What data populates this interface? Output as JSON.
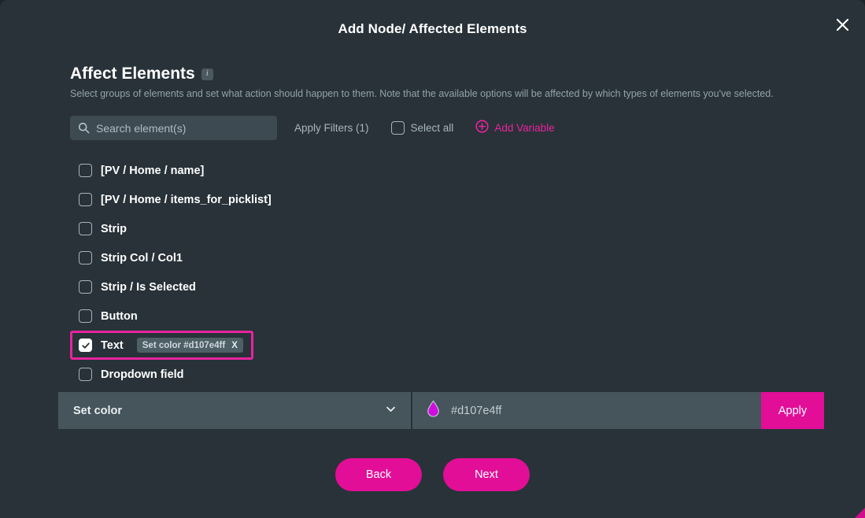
{
  "modal": {
    "title": "Add Node/ Affected Elements",
    "close_icon": "close-icon"
  },
  "section": {
    "title": "Affect Elements",
    "info_icon": "i",
    "description": "Select groups of elements and set what action should happen to them. Note that the available options will be affected by which types of elements you've selected."
  },
  "toolbar": {
    "search_placeholder": "Search element(s)",
    "search_value": "",
    "apply_filters_label": "Apply Filters (1)",
    "select_all_label": "Select all",
    "select_all_checked": false,
    "add_variable_label": "Add Variable"
  },
  "elements": [
    {
      "label": "[PV / Home / name]",
      "checked": false,
      "highlighted": false,
      "tag": null
    },
    {
      "label": "[PV / Home / items_for_picklist]",
      "checked": false,
      "highlighted": false,
      "tag": null
    },
    {
      "label": "Strip",
      "checked": false,
      "highlighted": false,
      "tag": null
    },
    {
      "label": "Strip Col / Col1",
      "checked": false,
      "highlighted": false,
      "tag": null
    },
    {
      "label": "Strip / Is Selected",
      "checked": false,
      "highlighted": false,
      "tag": null
    },
    {
      "label": "Button",
      "checked": false,
      "highlighted": false,
      "tag": null
    },
    {
      "label": "Text",
      "checked": true,
      "highlighted": true,
      "tag": {
        "label": "Set color #d107e4ff",
        "remove": "X"
      }
    },
    {
      "label": "Dropdown field",
      "checked": false,
      "highlighted": false,
      "tag": null
    }
  ],
  "action_bar": {
    "action_selected": "Set color",
    "color_value": "#d107e4ff",
    "apply_label": "Apply"
  },
  "footer": {
    "back_label": "Back",
    "next_label": "Next"
  },
  "colors": {
    "accent": "#e20e97",
    "swatch": "#d107e4",
    "background": "#283238",
    "panel": "#46545b"
  }
}
